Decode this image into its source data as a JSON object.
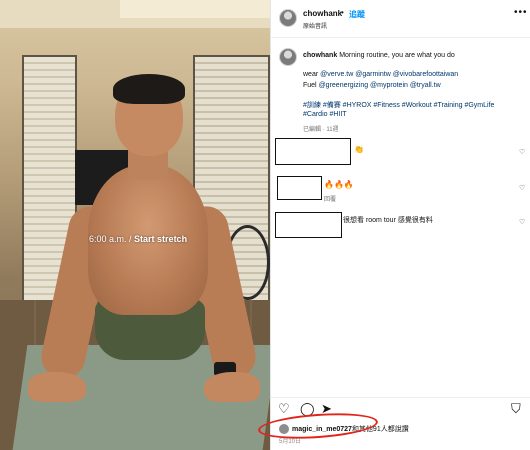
{
  "photo": {
    "overlay_time": "6:00 a.m. /",
    "overlay_action": "Start stretch"
  },
  "header": {
    "username": "chowhank",
    "dot": "•",
    "follow_label": "追蹤",
    "audio_label": "原始音訊",
    "more_label": "•••"
  },
  "caption": {
    "username": "chowhank",
    "text": "Morning routine, you are what you do",
    "wear_label": "wear",
    "wear_tags": "@verve.tw @garmintw @vivobarefoottaiwan",
    "fuel_label": "Fuel",
    "fuel_tags": "@greenergizing @myprotein @tryall.tw",
    "hashtags_1": "#訓練 #備賽 #HYROX #Fitness #Workout #Training #GymLife",
    "hashtags_2": "#Cardio #HIIT",
    "meta": "已編輯 · 11週"
  },
  "comments": [
    {
      "emoji": "👏",
      "reply_label": ""
    },
    {
      "emoji": "🔥🔥🔥",
      "reply_label": "回覆"
    },
    {
      "text": "很想看 room tour 感覺很有料"
    }
  ],
  "actions": {
    "like_icon": "♡",
    "comment_icon": "◯",
    "share_icon": "➤",
    "save_icon": "⛉"
  },
  "likes": {
    "username": "magic_in_me0727",
    "rest": "和其他91人都說讚"
  },
  "date": "5月10日",
  "colors": {
    "follow": "#0095f6",
    "link": "#00376b",
    "highlight_ring": "#e1251b"
  }
}
